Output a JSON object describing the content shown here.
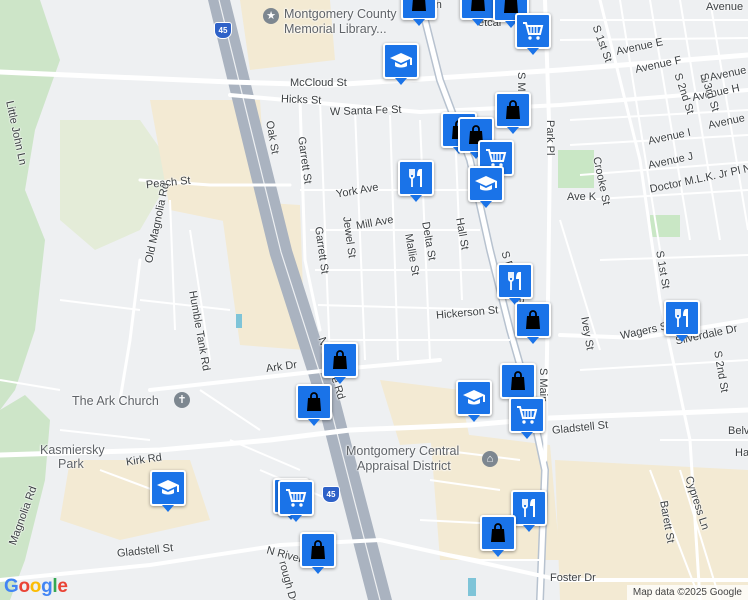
{
  "streets": {
    "mcCloud": "McCloud St",
    "hicks": "Hicks St",
    "santaFe": "W Santa Fe St",
    "oak": "Oak St",
    "garrett1": "Garrett St",
    "garrett2": "Garrett St",
    "peach": "Peach St",
    "york": "York Ave",
    "mill": "Mill Ave",
    "jewel": "Jewel St",
    "mallie": "Mallie St",
    "delta": "Delta St",
    "hall": "Hall St",
    "sfrazier": "S Frazier St",
    "hickerson": "Hickerson St",
    "ark": "Ark Dr",
    "serviceRd": "N Service Rd",
    "oldMagnolia": "Old Magnolia Rd",
    "humbleTank": "Humble Tank Rd",
    "littleJohn": "Little John Ln",
    "kirk": "Kirk Rd",
    "magnoliaRd": "Magnolia Rd",
    "gladstellW": "Gladstell St",
    "gladstellE": "Gladstell St",
    "nRiver": "N River",
    "boroughDr": "rough Dr",
    "fosterDr": "Foster Dr",
    "parkPl": "Park Pl",
    "sMain": "S Main",
    "sMainTop": "S M",
    "crooke": "Crooke St",
    "aveK": "Ave K",
    "ivey": "Ivey St",
    "wagers": "Wagers St",
    "silverdale": "Silverdale Dr",
    "s1st": "S 1st St",
    "s1stTop": "S 1st St",
    "s2nd": "S 2nd St",
    "s2ndB": "S 2nd St",
    "s3rd": "S 3rd St",
    "aveE": "Avenue E",
    "aveF": "Avenue F",
    "eAve": "E Avenue",
    "aveH": "Avenue H",
    "aveI": "Avenue I",
    "aveJ1": "Avenue J",
    "aveJ2": "Avenue J",
    "mlk": "Doctor M.L.K. Jr Pl N",
    "avenueTop": "Avenue",
    "barett": "Barett St",
    "cypress": "Cypress Ln",
    "belv": "Belv",
    "ha": "Ha",
    "metca": "etcal",
    "lmon": "lmon"
  },
  "pois": {
    "library1": "Montgomery County",
    "library2": "Memorial Library...",
    "church": "The Ark Church",
    "appraisal1": "Montgomery Central",
    "appraisal2": "Appraisal District",
    "park1": "Kasmiersky",
    "park2": "Park"
  },
  "highway": {
    "shield": "45"
  },
  "pins": [
    {
      "type": "shopping",
      "name": "shopping-pin-1"
    },
    {
      "type": "shopping",
      "name": "shopping-pin-2"
    },
    {
      "type": "shopping",
      "name": "shopping-pin-3"
    },
    {
      "type": "school",
      "name": "school-pin-1"
    },
    {
      "type": "grocery",
      "name": "grocery-pin-1"
    },
    {
      "type": "shopping",
      "name": "shopping-pin-4"
    },
    {
      "type": "shopping",
      "name": "shopping-pin-5"
    },
    {
      "type": "shopping",
      "name": "shopping-pin-6"
    },
    {
      "type": "restaurant",
      "name": "restaurant-pin-1"
    },
    {
      "type": "grocery",
      "name": "grocery-pin-2"
    },
    {
      "type": "school",
      "name": "school-pin-2"
    },
    {
      "type": "restaurant",
      "name": "restaurant-pin-2"
    },
    {
      "type": "shopping",
      "name": "shopping-pin-7"
    },
    {
      "type": "restaurant",
      "name": "restaurant-pin-3"
    },
    {
      "type": "shopping",
      "name": "shopping-pin-8"
    },
    {
      "type": "shopping",
      "name": "shopping-pin-9"
    },
    {
      "type": "shopping",
      "name": "shopping-pin-10"
    },
    {
      "type": "school",
      "name": "school-pin-3"
    },
    {
      "type": "grocery",
      "name": "grocery-pin-3"
    },
    {
      "type": "school",
      "name": "school-pin-4"
    },
    {
      "type": "shopping",
      "name": "shopping-pin-11"
    },
    {
      "type": "grocery",
      "name": "grocery-pin-4"
    },
    {
      "type": "restaurant",
      "name": "restaurant-pin-4"
    },
    {
      "type": "shopping",
      "name": "shopping-pin-12"
    },
    {
      "type": "shopping",
      "name": "shopping-pin-13"
    }
  ],
  "colors": {
    "pin": "#1a73e8",
    "park": "#c9e7c5",
    "highway": "#9aa5b5"
  },
  "logo": "Google",
  "attribution": "Map data ©2025 Google"
}
